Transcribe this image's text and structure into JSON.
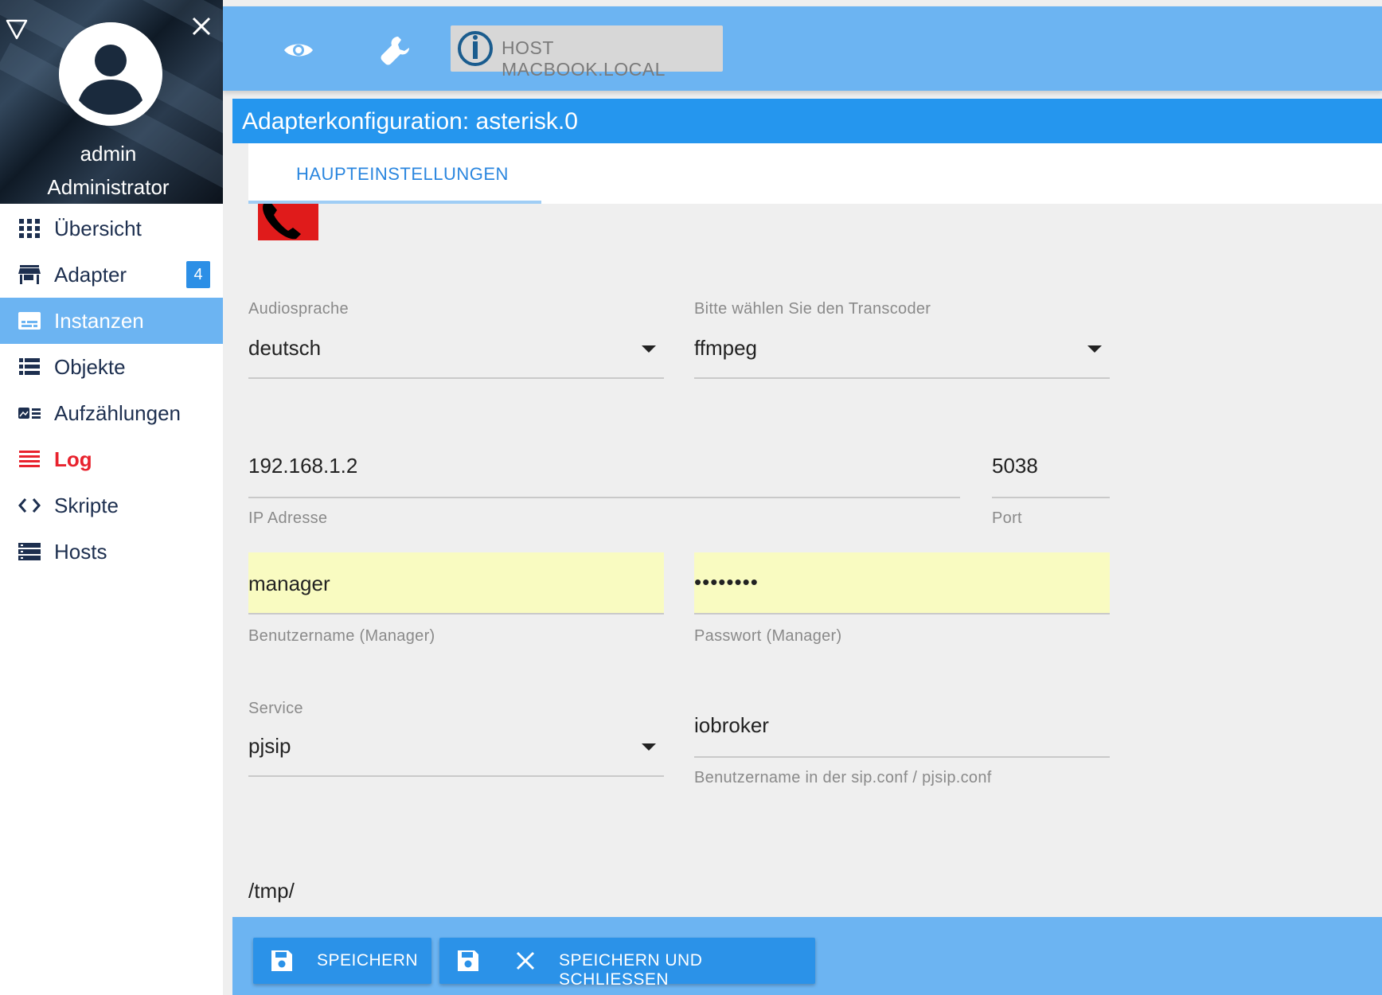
{
  "sidebar": {
    "user_name": "admin",
    "user_role": "Administrator",
    "items": [
      {
        "label": "Übersicht",
        "icon": "grid-icon"
      },
      {
        "label": "Adapter",
        "icon": "store-icon",
        "badge": "4"
      },
      {
        "label": "Instanzen",
        "icon": "instances-icon",
        "active": true
      },
      {
        "label": "Objekte",
        "icon": "list-icon"
      },
      {
        "label": "Aufzählungen",
        "icon": "enum-icon"
      },
      {
        "label": "Log",
        "icon": "log-icon"
      },
      {
        "label": "Skripte",
        "icon": "code-icon"
      },
      {
        "label": "Hosts",
        "icon": "hosts-icon"
      }
    ]
  },
  "topbar": {
    "host_label": "HOST MACBOOK.LOCAL"
  },
  "page": {
    "title": "Adapterkonfiguration: asterisk.0",
    "tab_main": "HAUPTEINSTELLUNGEN"
  },
  "form": {
    "language_label": "Audiosprache",
    "language_value": "deutsch",
    "transcoder_label": "Bitte wählen Sie den Transcoder",
    "transcoder_value": "ffmpeg",
    "ip_value": "192.168.1.2",
    "ip_label": "IP Adresse",
    "port_value": "5038",
    "port_label": "Port",
    "user_value": "manager",
    "user_label": "Benutzername (Manager)",
    "password_value": "••••••••",
    "password_label": "Passwort (Manager)",
    "service_label": "Service",
    "service_value": "pjsip",
    "sip_user_value": "iobroker",
    "sip_user_label": "Benutzername in der sip.conf / pjsip.conf",
    "path_value": "/tmp/"
  },
  "buttons": {
    "save": "SPEICHERN",
    "save_close": "SPEICHERN UND SCHLIESSEN"
  },
  "colors": {
    "accent": "#2596ee",
    "bar": "#6cb4f2",
    "log_red": "#e8232e",
    "autofill_yellow": "#f9fbc1"
  }
}
